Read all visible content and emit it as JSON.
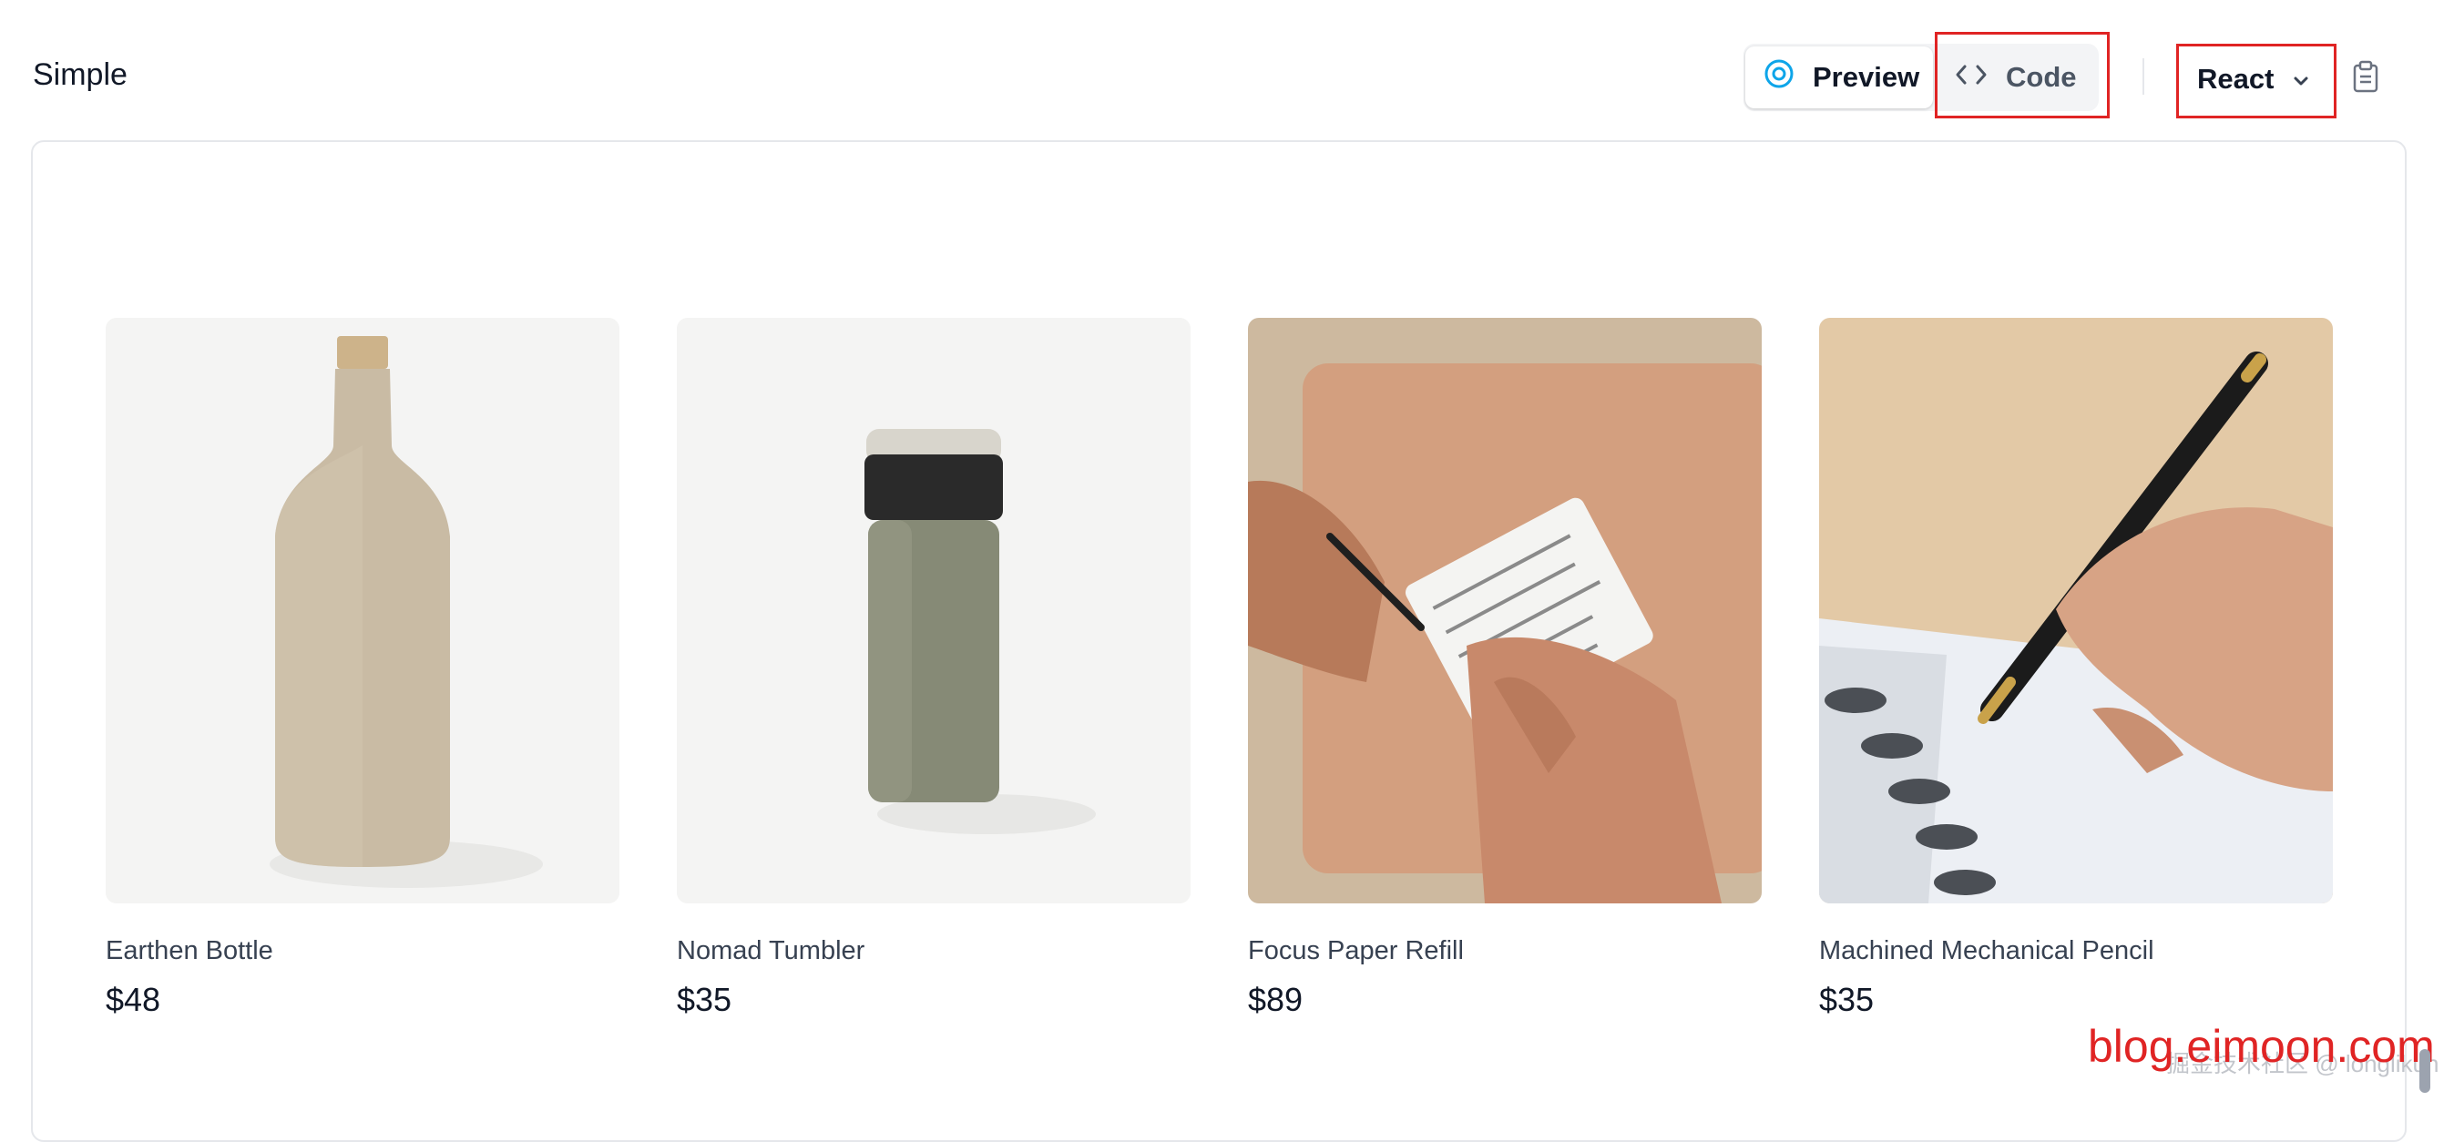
{
  "header": {
    "title": "Simple",
    "tabs": {
      "preview_label": "Preview",
      "code_label": "Code"
    },
    "framework_select": {
      "selected": "React"
    }
  },
  "icons": {
    "preview": "eye-icon",
    "code": "code-brackets-icon",
    "dropdown": "chevron-down-icon",
    "copy": "clipboard-icon"
  },
  "products": [
    {
      "name": "Earthen Bottle",
      "price": "$48"
    },
    {
      "name": "Nomad Tumbler",
      "price": "$35"
    },
    {
      "name": "Focus Paper Refill",
      "price": "$89"
    },
    {
      "name": "Machined Mechanical Pencil",
      "price": "$35"
    }
  ],
  "watermarks": {
    "red": "blog.eimoon.com",
    "grey": "掘金技术社区 @ longlikun"
  },
  "colors": {
    "highlight": "#e02424",
    "preview_icon": "#0ea5e9",
    "panel_border": "#e5e7eb"
  }
}
